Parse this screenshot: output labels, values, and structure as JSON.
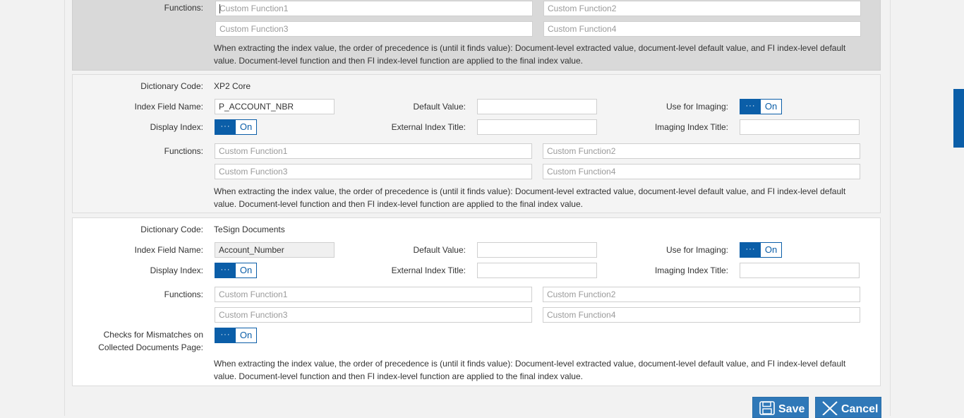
{
  "labels": {
    "functions": "Functions:",
    "dictionary_code": "Dictionary Code:",
    "index_field_name": "Index Field Name:",
    "default_value": "Default Value:",
    "use_for_imaging": "Use for Imaging:",
    "display_index": "Display Index:",
    "external_index_title": "External Index Title:",
    "imaging_index_title": "Imaging Index Title:",
    "checks_line1": "Checks for Mismatches on",
    "checks_line2": "Collected Documents Page:"
  },
  "placeholders": {
    "f1": "Custom Function1",
    "f2": "Custom Function2",
    "f3": "Custom Function3",
    "f4": "Custom Function4"
  },
  "toggle": {
    "knob": "···",
    "on": "On"
  },
  "note": {
    "line1": "When extracting the index value, the order of precedence is (until it finds value): Document-level extracted value, document-level default value, and FI index-level default",
    "line2": "value. Document-level function and then FI index-level function are applied to the final index value."
  },
  "sections": [
    {},
    {
      "dictionary_code": "XP2 Core",
      "index_field_name": "P_ACCOUNT_NBR",
      "default_value": "",
      "external_index_title": "",
      "imaging_index_title": ""
    },
    {
      "dictionary_code": "TeSign Documents",
      "index_field_name": "Account_Number",
      "default_value": "",
      "external_index_title": "",
      "imaging_index_title": ""
    }
  ],
  "buttons": {
    "save": "Save",
    "cancel": "Cancel"
  },
  "colors": {
    "accent": "#0b5ea8",
    "button": "#2f78b8"
  }
}
